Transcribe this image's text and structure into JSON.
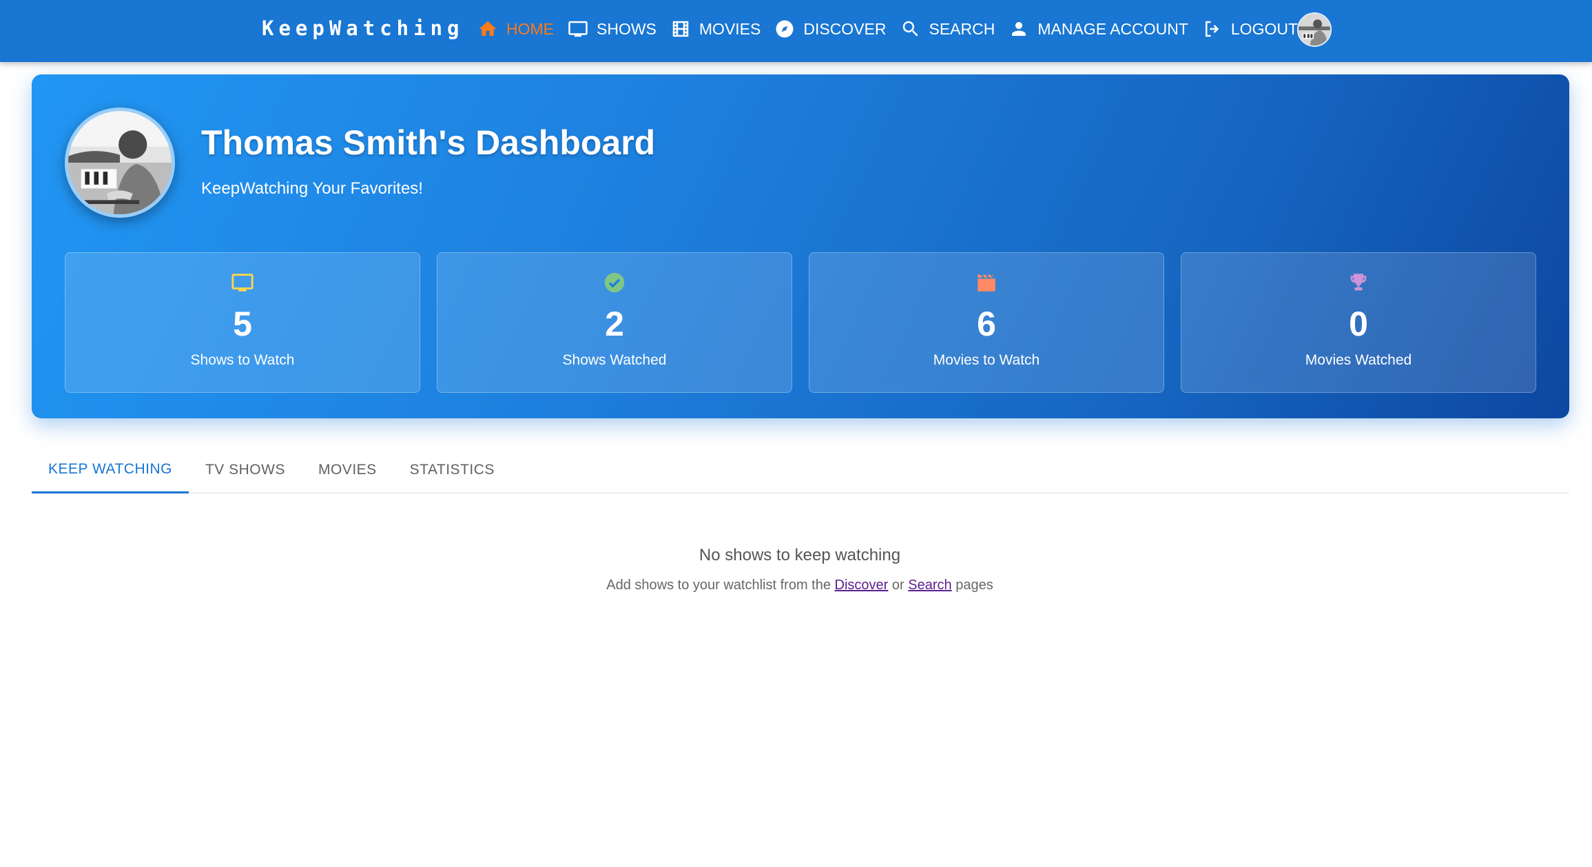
{
  "brand": "KeepWatching",
  "nav": {
    "items": [
      {
        "label": "HOME",
        "icon": "home-icon",
        "active": true
      },
      {
        "label": "SHOWS",
        "icon": "tv-icon",
        "active": false
      },
      {
        "label": "MOVIES",
        "icon": "film-icon",
        "active": false
      },
      {
        "label": "DISCOVER",
        "icon": "compass-icon",
        "active": false
      },
      {
        "label": "SEARCH",
        "icon": "search-icon",
        "active": false
      },
      {
        "label": "MANAGE ACCOUNT",
        "icon": "person-icon",
        "active": false
      },
      {
        "label": "LOGOUT",
        "icon": "logout-icon",
        "active": false
      }
    ]
  },
  "hero": {
    "title": "Thomas Smith's Dashboard",
    "subtitle": "KeepWatching Your Favorites!"
  },
  "stats": [
    {
      "value": "5",
      "label": "Shows to Watch",
      "icon": "tv-icon",
      "icon_color": "#ffd54f"
    },
    {
      "value": "2",
      "label": "Shows Watched",
      "icon": "check-circle-icon",
      "icon_color": "#81c784"
    },
    {
      "value": "6",
      "label": "Movies to Watch",
      "icon": "clapperboard-icon",
      "icon_color": "#ff8a65"
    },
    {
      "value": "0",
      "label": "Movies Watched",
      "icon": "trophy-icon",
      "icon_color": "#ce93d8"
    }
  ],
  "tabs": [
    {
      "label": "KEEP WATCHING",
      "active": true
    },
    {
      "label": "TV SHOWS",
      "active": false
    },
    {
      "label": "MOVIES",
      "active": false
    },
    {
      "label": "STATISTICS",
      "active": false
    }
  ],
  "empty_state": {
    "title": "No shows to keep watching",
    "prefix": "Add shows to your watchlist from the",
    "link1": "Discover",
    "middle": "or",
    "link2": "Search",
    "suffix": "pages"
  },
  "colors": {
    "primary": "#1976d2",
    "active_nav": "#ff7a1a"
  }
}
